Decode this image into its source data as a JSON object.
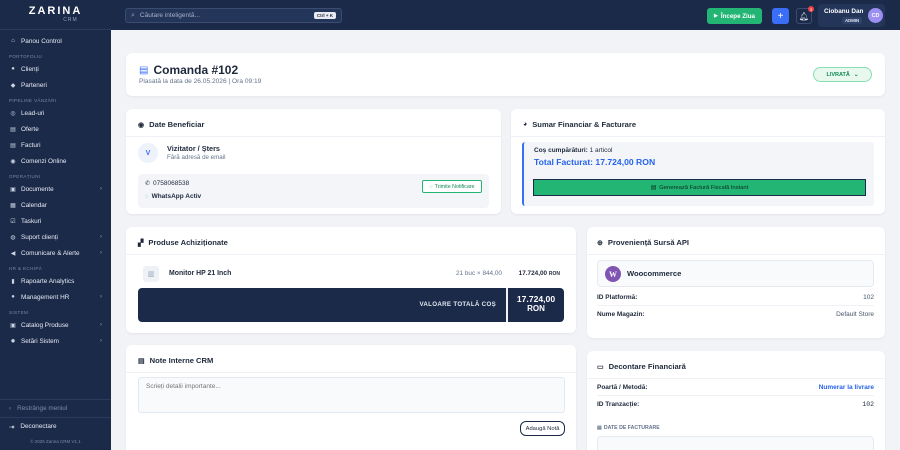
{
  "app": {
    "logo_main": "ZARINA",
    "logo_sub": "CRM",
    "copyright": "© 2026 Zarina CRM V1.1"
  },
  "sidebar": {
    "items": [
      {
        "type": "item",
        "label": "Panou Control",
        "icon": "home-icon",
        "glyph": "⌂",
        "chevron": false
      },
      {
        "type": "section",
        "label": "PORTOFOLIU"
      },
      {
        "type": "item",
        "label": "Clienți",
        "icon": "user-icon",
        "glyph": "●",
        "chevron": false
      },
      {
        "type": "item",
        "label": "Parteneri",
        "icon": "handshake-icon",
        "glyph": "◆",
        "chevron": false
      },
      {
        "type": "section",
        "label": "PIPELINE VÂNZĂRI"
      },
      {
        "type": "item",
        "label": "Lead-uri",
        "icon": "target-icon",
        "glyph": "◎",
        "chevron": false
      },
      {
        "type": "item",
        "label": "Oferte",
        "icon": "file-icon",
        "glyph": "▤",
        "chevron": false
      },
      {
        "type": "item",
        "label": "Facturi",
        "icon": "invoice-icon",
        "glyph": "▤",
        "chevron": false
      },
      {
        "type": "item",
        "label": "Comenzi Online",
        "icon": "cart-icon",
        "glyph": "◉",
        "chevron": false
      },
      {
        "type": "section",
        "label": "OPERAȚIUNI"
      },
      {
        "type": "item",
        "label": "Documente",
        "icon": "folder-icon",
        "glyph": "▣",
        "chevron": true
      },
      {
        "type": "item",
        "label": "Calendar",
        "icon": "calendar-icon",
        "glyph": "▦",
        "chevron": false
      },
      {
        "type": "item",
        "label": "Taskuri",
        "icon": "tasks-icon",
        "glyph": "☑",
        "chevron": false
      },
      {
        "type": "item",
        "label": "Suport clienți",
        "icon": "support-icon",
        "glyph": "◍",
        "chevron": true
      },
      {
        "type": "item",
        "label": "Comunicare & Alerte",
        "icon": "megaphone-icon",
        "glyph": "◀",
        "chevron": true
      },
      {
        "type": "section",
        "label": "HR & ECHIPĂ"
      },
      {
        "type": "item",
        "label": "Rapoarte Analytics",
        "icon": "chart-icon",
        "glyph": "▮",
        "chevron": false
      },
      {
        "type": "item",
        "label": "Management HR",
        "icon": "users-icon",
        "glyph": "●",
        "chevron": true
      },
      {
        "type": "section",
        "label": "SISTEM"
      },
      {
        "type": "item",
        "label": "Catalog Produse",
        "icon": "box-icon",
        "glyph": "▣",
        "chevron": true
      },
      {
        "type": "item",
        "label": "Setări Sistem",
        "icon": "gear-icon",
        "glyph": "✹",
        "chevron": true
      }
    ],
    "collapse_label": "Restrânge meniul",
    "logout_label": "Deconectare"
  },
  "topbar": {
    "search_placeholder": "Căutare inteligentă...",
    "search_shortcut": "Ctrl + K",
    "start_label": "Începe Ziua",
    "notifications_count": "3",
    "user_name": "Ciobanu Dan",
    "user_role": "ADMIN",
    "user_initials": "CD"
  },
  "order": {
    "title": "Comanda #102",
    "subtitle": "Plasată la data de 26.05.2026 | Ora 09:19",
    "status": "LIVRATĂ"
  },
  "beneficiary": {
    "title": "Date Beneficiar",
    "avatar_letter": "V",
    "name": "Vizitator / Șters",
    "address": "Fără adresă de email",
    "phone": "0758068538",
    "whatsapp": "WhatsApp Activ",
    "notify_button": "Trimite Notificare"
  },
  "financial": {
    "title": "Sumar Financiar & Facturare",
    "cart_label": "Coș cumpărături:",
    "cart_value": "1 articol",
    "total_label": "Total Facturat: 17.724,00 RON",
    "generate_button": "Generează Factură Fiscală Instant"
  },
  "products": {
    "title": "Produse Achiziționate",
    "items": [
      {
        "name": "Monitor HP 21 Inch",
        "qty": "21 buc × 844,00",
        "total": "17.724,00",
        "currency": "RON"
      }
    ],
    "total_label": "VALOARE TOTALĂ COȘ",
    "total_value": "17.724,00",
    "total_currency": "RON"
  },
  "source": {
    "title": "Proveniență Sursă API",
    "platform_name": "Woocommerce",
    "rows": [
      {
        "label": "ID Platformă:",
        "value": "102"
      },
      {
        "label": "Nume Magazin:",
        "value": "Default Store"
      }
    ]
  },
  "notes": {
    "title": "Note Interne CRM",
    "placeholder": "Scrieți detalii importante...",
    "add_button": "Adaugă Notă"
  },
  "settlement": {
    "title": "Decontare Financiară",
    "gateway_label": "Poartă / Metodă:",
    "gateway_value": "Numerar la livrare",
    "transaction_label": "ID Tranzacție:",
    "transaction_value": "102",
    "billing_label": "DATE DE FACTURARE"
  },
  "colors": {
    "sidebar": "#1c2a4a",
    "accent": "#3b6ef6",
    "success": "#22b573",
    "dark": "#1c2a4a"
  }
}
